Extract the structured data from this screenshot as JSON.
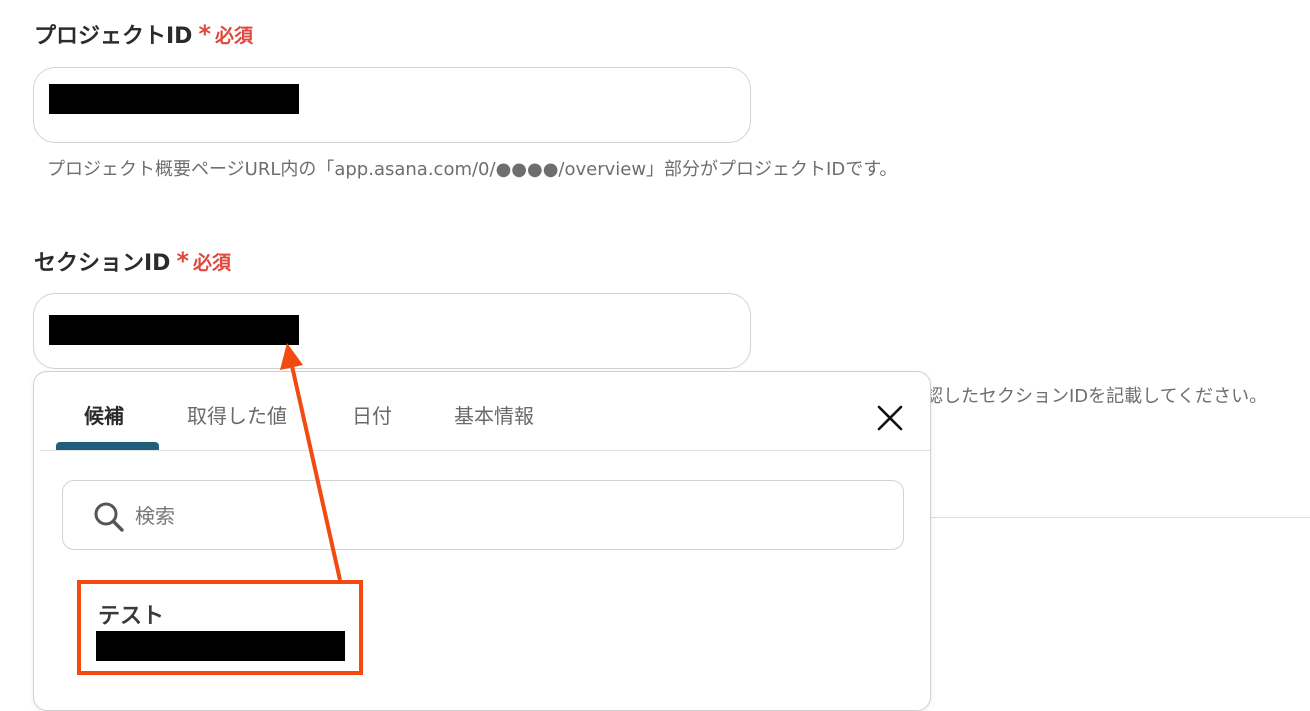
{
  "project_field": {
    "label": "プロジェクトID",
    "required_mark": "*",
    "required_text": "必須",
    "help": "プロジェクト概要ページURL内の「app.asana.com/0/●●●●/overview」部分がプロジェクトIDです。"
  },
  "section_field": {
    "label": "セクションID",
    "required_mark": "*",
    "required_text": "必須",
    "help_visible": "認したセクションIDを記載してください。"
  },
  "popup": {
    "tabs": [
      {
        "label": "候補",
        "active": true
      },
      {
        "label": "取得した値",
        "active": false
      },
      {
        "label": "日付",
        "active": false
      },
      {
        "label": "基本情報",
        "active": false
      }
    ],
    "search": {
      "placeholder": "検索"
    },
    "candidates": [
      {
        "name": "テスト"
      }
    ]
  },
  "colors": {
    "required": "#e0483e",
    "tab_indicator": "#1f5f7a",
    "annotation": "#f24a10",
    "redaction": "#000000"
  },
  "icons": {
    "close": "close-icon",
    "search": "search-icon",
    "arrow": "annotation-arrow"
  }
}
